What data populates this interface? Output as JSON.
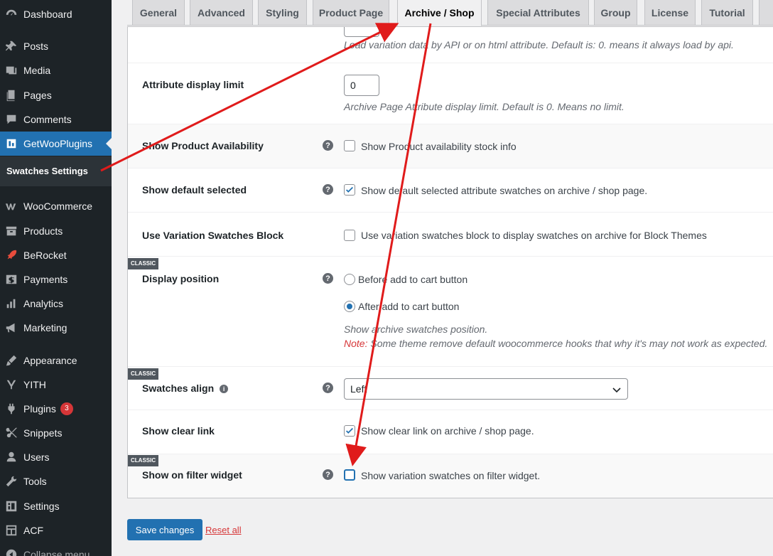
{
  "sidebar": {
    "items": [
      {
        "label": "Dashboard",
        "icon": "dashboard-icon"
      },
      {
        "label": "Posts",
        "icon": "pin-icon"
      },
      {
        "label": "Media",
        "icon": "media-icon"
      },
      {
        "label": "Pages",
        "icon": "page-icon"
      },
      {
        "label": "Comments",
        "icon": "comment-icon"
      },
      {
        "label": "GetWooPlugins",
        "icon": "plugin-logo-icon"
      },
      {
        "label": "WooCommerce",
        "icon": "woo-icon"
      },
      {
        "label": "Products",
        "icon": "archive-icon"
      },
      {
        "label": "BeRocket",
        "icon": "rocket-icon"
      },
      {
        "label": "Payments",
        "icon": "dollar-icon"
      },
      {
        "label": "Analytics",
        "icon": "chart-icon"
      },
      {
        "label": "Marketing",
        "icon": "megaphone-icon"
      },
      {
        "label": "Appearance",
        "icon": "brush-icon"
      },
      {
        "label": "YITH",
        "icon": "yith-icon"
      },
      {
        "label": "Plugins",
        "icon": "plugin-icon",
        "badge": "3"
      },
      {
        "label": "Snippets",
        "icon": "scissors-icon"
      },
      {
        "label": "Users",
        "icon": "user-icon"
      },
      {
        "label": "Tools",
        "icon": "wrench-icon"
      },
      {
        "label": "Settings",
        "icon": "settings-icon"
      },
      {
        "label": "ACF",
        "icon": "acf-icon"
      },
      {
        "label": "Collapse menu",
        "icon": "collapse-icon"
      }
    ],
    "submenu_label": "Swatches Settings"
  },
  "tabs": [
    "General",
    "Advanced",
    "Styling",
    "Product Page",
    "Archive / Shop",
    "Special Attributes",
    "Group",
    "License",
    "Tutorial"
  ],
  "settings": {
    "threshold_desc": "Load variation data by API or on html attribute. Default is: 0. means it always load by api.",
    "limit": {
      "label": "Attribute display limit",
      "value": "0",
      "desc": "Archive Page Attribute display limit. Default is 0. Means no limit."
    },
    "availability": {
      "label": "Show Product Availability",
      "option": "Show Product availability stock info",
      "checked": false
    },
    "default_selected": {
      "label": "Show default selected",
      "option": "Show default selected attribute swatches on archive / shop page.",
      "checked": true
    },
    "block": {
      "label": "Use Variation Swatches Block",
      "option": "Use variation swatches block to display swatches on archive for Block Themes",
      "checked": false
    },
    "position": {
      "badge": "CLASSIC",
      "label": "Display position",
      "options": [
        "Before add to cart button",
        "After add to cart button"
      ],
      "selected": "After add to cart button",
      "desc": "Show archive swatches position.",
      "note_label": "Note:",
      "note_text": " Some theme remove default woocommerce hooks that why it's may not work as expected."
    },
    "align": {
      "badge": "CLASSIC",
      "label": "Swatches align",
      "value": "Left"
    },
    "clear_link": {
      "label": "Show clear link",
      "option": "Show clear link on archive / shop page.",
      "checked": true
    },
    "filter_widget": {
      "badge": "CLASSIC",
      "label": "Show on filter widget",
      "option": "Show variation swatches on filter widget.",
      "checked": false
    }
  },
  "footer": {
    "save": "Save changes",
    "reset": "Reset all"
  },
  "colors": {
    "accent": "#2271b1",
    "sidebar": "#1d2327",
    "annotation": "#e01b1b"
  }
}
